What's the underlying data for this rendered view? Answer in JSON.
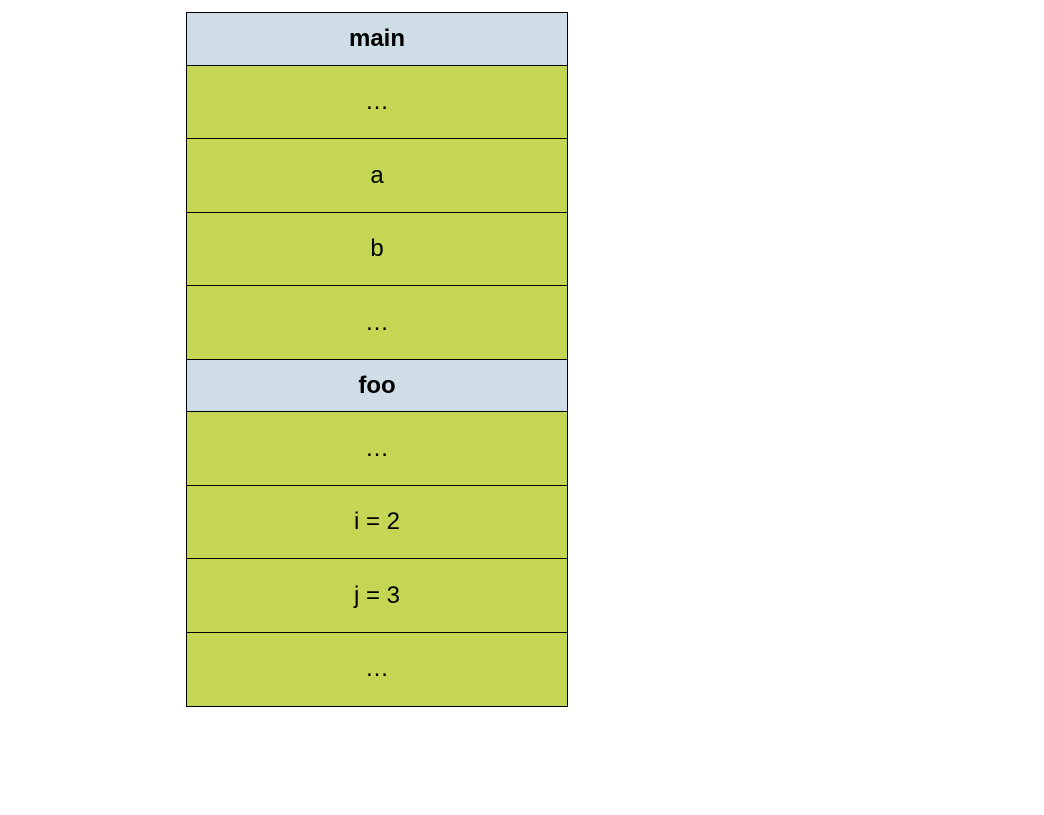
{
  "diagram": {
    "frames": [
      {
        "header": "main",
        "cells": [
          "…",
          "a",
          "b",
          "…"
        ]
      },
      {
        "header": "foo",
        "cells": [
          "…",
          "i = 2",
          "j = 3",
          "…"
        ]
      }
    ]
  },
  "colors": {
    "header_bg": "#cfdee6",
    "cell_bg": "#c4d654",
    "border": "#000000"
  }
}
